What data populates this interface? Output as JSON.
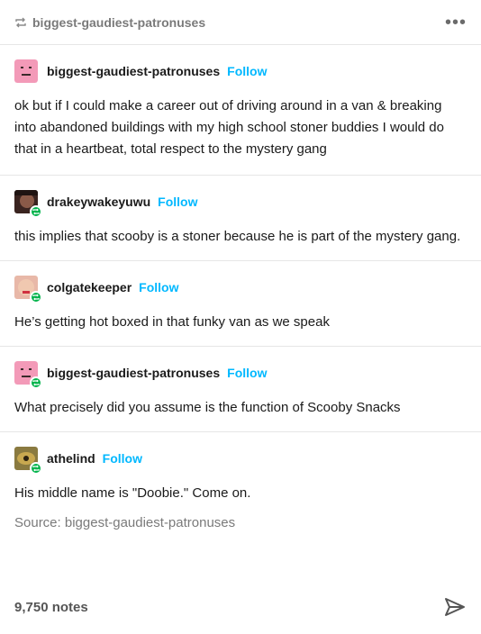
{
  "header": {
    "reblogged_from": "biggest-gaudiest-patronuses",
    "more_label": "•••"
  },
  "entries": [
    {
      "username": "biggest-gaudiest-patronuses",
      "follow_label": "Follow",
      "text": "ok but if I could make a career out of driving around in a van & breaking into abandoned buildings with my high school stoner buddies I would do that in a heartbeat, total respect to the mystery gang",
      "avatar": "pink-face"
    },
    {
      "username": "drakeywakeyuwu",
      "follow_label": "Follow",
      "text": "this implies that scooby is a stoner because he is part of the mystery gang.",
      "avatar": "photo"
    },
    {
      "username": "colgatekeeper",
      "follow_label": "Follow",
      "text": "He’s getting hot boxed in that funky van as we speak",
      "avatar": "photo"
    },
    {
      "username": "biggest-gaudiest-patronuses",
      "follow_label": "Follow",
      "text": "What precisely did you assume is the function of Scooby Snacks",
      "avatar": "pink-face"
    },
    {
      "username": "athelind",
      "follow_label": "Follow",
      "text": "His middle name is \"Doobie.\" Come on.",
      "avatar": "photo"
    }
  ],
  "source": {
    "label": "Source: biggest-gaudiest-patronuses"
  },
  "footer": {
    "notes": "9,750 notes"
  },
  "colors": {
    "accent": "#00b8ff",
    "reblog_badge": "#00b34a",
    "text": "#1a1a1a",
    "muted": "#7a7a7a"
  }
}
